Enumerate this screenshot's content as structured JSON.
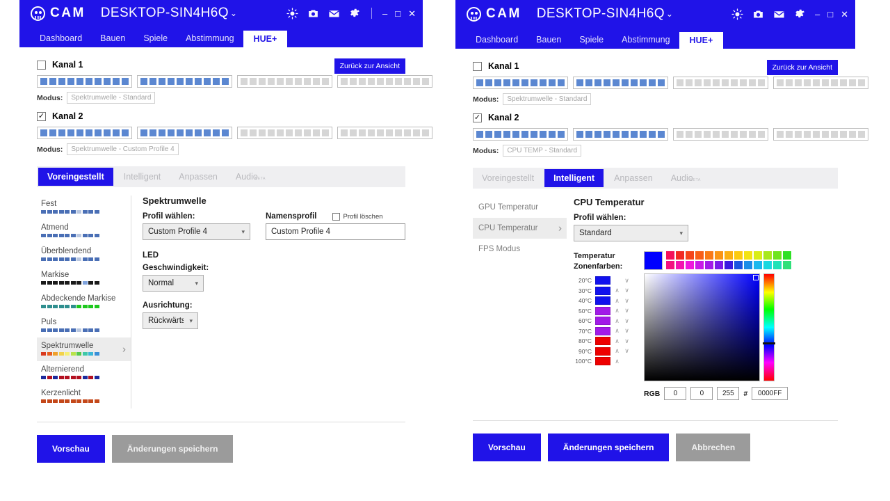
{
  "app": {
    "brand": "CAM",
    "machine": "DESKTOP-SIN4H6Q",
    "caret": "⌄",
    "titlebar_icons": [
      "brightness-icon",
      "camera-icon",
      "mail-icon",
      "gear-icon"
    ],
    "window_buttons": {
      "minimize": "–",
      "maximize": "□",
      "close": "✕"
    },
    "nav_tabs": [
      "Dashboard",
      "Bauen",
      "Spiele",
      "Abstimmung",
      "HUE+"
    ],
    "nav_active": "HUE+"
  },
  "colors": {
    "accent": "#2013E8",
    "led_on": "#5B87D1",
    "led_off": "#D6D6D6",
    "disabled_button": "#9B9B9B",
    "selected_row": "#ECECEC"
  },
  "left": {
    "back_button": "Zurück zur Ansicht",
    "channels": [
      {
        "label": "Kanal 1",
        "checked": false,
        "modus_label": "Modus:",
        "modus_value": "Spektrumwelle - Standard",
        "strips": [
          true,
          true,
          false,
          false
        ]
      },
      {
        "label": "Kanal 2",
        "checked": true,
        "modus_label": "Modus:",
        "modus_value": "Spektrumwelle - Custom Profile 4",
        "strips": [
          true,
          true,
          false,
          false
        ]
      }
    ],
    "subtabs": [
      {
        "label": "Voreingestellt",
        "active": true,
        "beta": ""
      },
      {
        "label": "Intelligent",
        "active": false,
        "beta": ""
      },
      {
        "label": "Anpassen",
        "active": false,
        "beta": ""
      },
      {
        "label": "Audio",
        "active": false,
        "beta": "BETA"
      }
    ],
    "presets": [
      {
        "name": "Fest",
        "selected": false,
        "swatches": [
          "#4a6fb5",
          "#4a6fb5",
          "#4a6fb5",
          "#4a6fb5",
          "#4a6fb5",
          "#4a6fb5",
          "#b9c7e0",
          "#4a6fb5",
          "#4a6fb5",
          "#4a6fb5"
        ]
      },
      {
        "name": "Atmend",
        "selected": false,
        "swatches": [
          "#4a6fb5",
          "#4a6fb5",
          "#4a6fb5",
          "#4a6fb5",
          "#4a6fb5",
          "#4a6fb5",
          "#b9c7e0",
          "#4a6fb5",
          "#4a6fb5",
          "#4a6fb5"
        ]
      },
      {
        "name": "Überblendend",
        "selected": false,
        "swatches": [
          "#4a6fb5",
          "#4a6fb5",
          "#4a6fb5",
          "#4a6fb5",
          "#4a6fb5",
          "#4a6fb5",
          "#b9c7e0",
          "#4a6fb5",
          "#4a6fb5",
          "#4a6fb5"
        ]
      },
      {
        "name": "Markise",
        "selected": false,
        "swatches": [
          "#1a1a1a",
          "#1a1a1a",
          "#1a1a1a",
          "#1a1a1a",
          "#1a1a1a",
          "#1a1a1a",
          "#1a1a1a",
          "#7fa3dd",
          "#1a1a1a",
          "#1a1a1a"
        ]
      },
      {
        "name": "Abdeckende Markise",
        "selected": false,
        "swatches": [
          "#2f8f8f",
          "#2f8f8f",
          "#2f8f8f",
          "#2f8f8f",
          "#2f8f8f",
          "#2f8f8f",
          "#1ec81e",
          "#1ec81e",
          "#1ec81e",
          "#1ec81e"
        ]
      },
      {
        "name": "Puls",
        "selected": false,
        "swatches": [
          "#4a6fb5",
          "#4a6fb5",
          "#4a6fb5",
          "#4a6fb5",
          "#4a6fb5",
          "#4a6fb5",
          "#b9c7e0",
          "#4a6fb5",
          "#4a6fb5",
          "#4a6fb5"
        ]
      },
      {
        "name": "Spektrumwelle",
        "selected": true,
        "swatches": [
          "#d93a1e",
          "#e85c1e",
          "#efa02a",
          "#f2d24a",
          "#f6ef74",
          "#b8e34a",
          "#56c94a",
          "#3ec8a8",
          "#3ab7d8",
          "#3a8fd8"
        ]
      },
      {
        "name": "Alternierend",
        "selected": false,
        "swatches": [
          "#1c2a9c",
          "#b31020",
          "#1c2a9c",
          "#b31020",
          "#b31020",
          "#b31020",
          "#b31020",
          "#1c2a9c",
          "#b31020",
          "#1c2a9c"
        ]
      },
      {
        "name": "Kerzenlicht",
        "selected": false,
        "swatches": [
          "#c4481a",
          "#c4481a",
          "#c4481a",
          "#c4481a",
          "#c4481a",
          "#c4481a",
          "#c4481a",
          "#c4481a",
          "#c4481a",
          "#c4481a"
        ]
      }
    ],
    "detail": {
      "title": "Spektrumwelle",
      "profile_label": "Profil wählen:",
      "profile_value": "Custom Profile 4",
      "name_profile_label": "Namensprofil",
      "delete_profile_label": "Profil löschen",
      "delete_profile_checked": false,
      "name_profile_value": "Custom Profile 4",
      "led_section": "LED",
      "speed_label": "Geschwindigkeit:",
      "speed_value": "Normal",
      "direction_label": "Ausrichtung:",
      "direction_value": "Rückwärts"
    },
    "footer_buttons": [
      {
        "label": "Vorschau",
        "style": "primary"
      },
      {
        "label": "Änderungen speichern",
        "style": "disabled"
      }
    ]
  },
  "right": {
    "back_button": "Zurück zur Ansicht",
    "channels": [
      {
        "label": "Kanal 1",
        "checked": false,
        "modus_label": "Modus:",
        "modus_value": "Spektrumwelle - Standard",
        "strips": [
          true,
          true,
          false,
          false
        ]
      },
      {
        "label": "Kanal 2",
        "checked": true,
        "modus_label": "Modus:",
        "modus_value": "CPU TEMP - Standard",
        "strips": [
          true,
          true,
          false,
          false
        ]
      }
    ],
    "subtabs": [
      {
        "label": "Voreingestellt",
        "active": false,
        "beta": ""
      },
      {
        "label": "Intelligent",
        "active": true,
        "beta": ""
      },
      {
        "label": "Anpassen",
        "active": false,
        "beta": ""
      },
      {
        "label": "Audio",
        "active": false,
        "beta": "BETA"
      }
    ],
    "smart_items": [
      {
        "label": "GPU Temperatur",
        "selected": false
      },
      {
        "label": "CPU Temperatur",
        "selected": true
      },
      {
        "label": "FPS Modus",
        "selected": false
      }
    ],
    "detail": {
      "title": "CPU Temperatur",
      "profile_label": "Profil wählen:",
      "profile_value": "Standard",
      "zone_label_line1": "Temperatur",
      "zone_label_line2": "Zonenfarben:"
    },
    "temperature_zones": [
      {
        "temp": "20°C",
        "color": "#1111ee",
        "up": false,
        "down": true
      },
      {
        "temp": "30°C",
        "color": "#1111ee",
        "up": true,
        "down": true
      },
      {
        "temp": "40°C",
        "color": "#1111ee",
        "up": true,
        "down": true
      },
      {
        "temp": "50°C",
        "color": "#a21ae8",
        "up": true,
        "down": true
      },
      {
        "temp": "60°C",
        "color": "#a21ae8",
        "up": true,
        "down": true
      },
      {
        "temp": "70°C",
        "color": "#a21ae8",
        "up": true,
        "down": true
      },
      {
        "temp": "80°C",
        "color": "#ee0000",
        "up": true,
        "down": true
      },
      {
        "temp": "90°C",
        "color": "#ee0000",
        "up": true,
        "down": true
      },
      {
        "temp": "100°C",
        "color": "#ee0000",
        "up": true,
        "down": false
      }
    ],
    "color_picker": {
      "current_color": "#0000FF",
      "palette_row_1": [
        "#f4125a",
        "#f22a22",
        "#f5451a",
        "#f85f18",
        "#f97a16",
        "#fa9514",
        "#fbb012",
        "#fccb10",
        "#f3e313",
        "#d9ed16",
        "#a8e81b",
        "#6fe41f",
        "#2fe025"
      ],
      "palette_row_2": [
        "#f21280",
        "#f214b0",
        "#ee18dd",
        "#c81ae8",
        "#a21ae8",
        "#7a1ae8",
        "#3a1ae0",
        "#1a54e0",
        "#1a8ce8",
        "#1ab8ee",
        "#1ad8e0",
        "#1fe2b8",
        "#2fe07a"
      ],
      "rgb_label": "RGB",
      "r": "0",
      "g": "0",
      "b": "255",
      "hash": "#",
      "hex": "0000FF"
    },
    "footer_buttons": [
      {
        "label": "Vorschau",
        "style": "primary"
      },
      {
        "label": "Änderungen speichern",
        "style": "primary"
      },
      {
        "label": "Abbrechen",
        "style": "disabled"
      }
    ]
  }
}
